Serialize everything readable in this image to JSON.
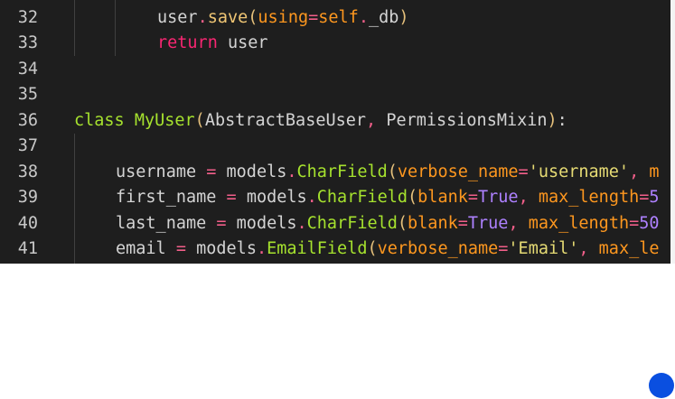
{
  "editor": {
    "lines": [
      {
        "number": "32",
        "tokens": [
          {
            "t": "user",
            "c": "ident"
          },
          {
            "t": ".",
            "c": "op"
          },
          {
            "t": "save",
            "c": "method"
          },
          {
            "t": "(",
            "c": "paren"
          },
          {
            "t": "using",
            "c": "param"
          },
          {
            "t": "=",
            "c": "op"
          },
          {
            "t": "self",
            "c": "param"
          },
          {
            "t": ".",
            "c": "op"
          },
          {
            "t": "_db",
            "c": "ident"
          },
          {
            "t": ")",
            "c": "paren"
          }
        ]
      },
      {
        "number": "33",
        "tokens": [
          {
            "t": "return",
            "c": "keyword"
          },
          {
            "t": " user",
            "c": "ident"
          }
        ]
      },
      {
        "number": "34",
        "tokens": []
      },
      {
        "number": "35",
        "tokens": []
      },
      {
        "number": "36",
        "tokens": [
          {
            "t": "class",
            "c": "decl"
          },
          {
            "t": " ",
            "c": "ident"
          },
          {
            "t": "MyUser",
            "c": "class"
          },
          {
            "t": "(",
            "c": "paren"
          },
          {
            "t": "AbstractBaseUser",
            "c": "ident"
          },
          {
            "t": ", ",
            "c": "comma"
          },
          {
            "t": "PermissionsMixin",
            "c": "ident"
          },
          {
            "t": ")",
            "c": "paren"
          },
          {
            "t": ":",
            "c": "punct"
          }
        ]
      },
      {
        "number": "37",
        "tokens": []
      },
      {
        "number": "38",
        "tokens": [
          {
            "t": "username",
            "c": "ident"
          },
          {
            "t": " = ",
            "c": "op"
          },
          {
            "t": "models",
            "c": "ident"
          },
          {
            "t": ".",
            "c": "op"
          },
          {
            "t": "CharField",
            "c": "class"
          },
          {
            "t": "(",
            "c": "paren"
          },
          {
            "t": "verbose_name",
            "c": "param"
          },
          {
            "t": "=",
            "c": "op"
          },
          {
            "t": "'username'",
            "c": "string"
          },
          {
            "t": ", ",
            "c": "comma"
          },
          {
            "t": "m",
            "c": "param"
          }
        ]
      },
      {
        "number": "39",
        "tokens": [
          {
            "t": "first_name",
            "c": "ident"
          },
          {
            "t": " = ",
            "c": "op"
          },
          {
            "t": "models",
            "c": "ident"
          },
          {
            "t": ".",
            "c": "op"
          },
          {
            "t": "CharField",
            "c": "class"
          },
          {
            "t": "(",
            "c": "paren"
          },
          {
            "t": "blank",
            "c": "param"
          },
          {
            "t": "=",
            "c": "op"
          },
          {
            "t": "True",
            "c": "const"
          },
          {
            "t": ", ",
            "c": "comma"
          },
          {
            "t": "max_length",
            "c": "param"
          },
          {
            "t": "=",
            "c": "op"
          },
          {
            "t": "5",
            "c": "number"
          }
        ]
      },
      {
        "number": "40",
        "tokens": [
          {
            "t": "last_name",
            "c": "ident"
          },
          {
            "t": " = ",
            "c": "op"
          },
          {
            "t": "models",
            "c": "ident"
          },
          {
            "t": ".",
            "c": "op"
          },
          {
            "t": "CharField",
            "c": "class"
          },
          {
            "t": "(",
            "c": "paren"
          },
          {
            "t": "blank",
            "c": "param"
          },
          {
            "t": "=",
            "c": "op"
          },
          {
            "t": "True",
            "c": "const"
          },
          {
            "t": ", ",
            "c": "comma"
          },
          {
            "t": "max_length",
            "c": "param"
          },
          {
            "t": "=",
            "c": "op"
          },
          {
            "t": "50",
            "c": "number"
          }
        ]
      },
      {
        "number": "41",
        "tokens": [
          {
            "t": "email",
            "c": "ident"
          },
          {
            "t": " = ",
            "c": "op"
          },
          {
            "t": "models",
            "c": "ident"
          },
          {
            "t": ".",
            "c": "op"
          },
          {
            "t": "EmailField",
            "c": "class"
          },
          {
            "t": "(",
            "c": "paren"
          },
          {
            "t": "verbose_name",
            "c": "param"
          },
          {
            "t": "=",
            "c": "op"
          },
          {
            "t": "'Email'",
            "c": "string"
          },
          {
            "t": ", ",
            "c": "comma"
          },
          {
            "t": "max_le",
            "c": "param"
          }
        ]
      }
    ]
  },
  "colors": {
    "editor_background": "#1e1e1e",
    "line_number": "#c8c8c8",
    "fab": "#0a4fe0"
  }
}
